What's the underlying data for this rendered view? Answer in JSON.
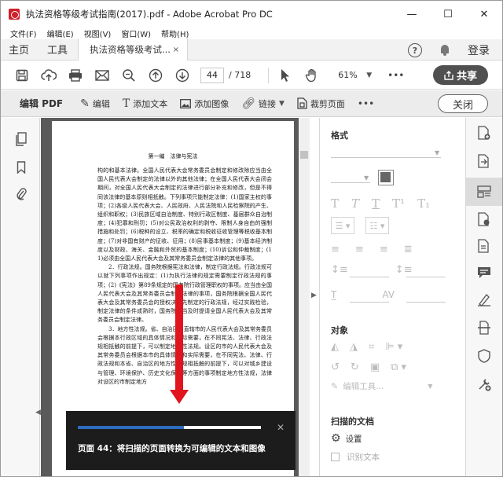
{
  "window": {
    "title": "执法资格等级考试指南(2017).pdf - Adobe Acrobat Pro DC",
    "minimize": "—",
    "maximize": "☐",
    "close": "✕"
  },
  "menu": [
    "文件(F)",
    "编辑(E)",
    "视图(V)",
    "窗口(W)",
    "帮助(H)"
  ],
  "tabs": {
    "home": "主页",
    "tools": "工具",
    "doc": "执法资格等级考试...",
    "doc_close": "×",
    "help": "?",
    "login": "登录"
  },
  "toolbar": {
    "page_current": "44",
    "page_total": "/ 718",
    "zoom": "61%",
    "more": "•••",
    "share": "共享"
  },
  "editbar": {
    "label": "编辑 PDF",
    "tools": [
      "编辑",
      "添加文本",
      "添加图像",
      "链接",
      "裁剪页面"
    ],
    "more": "•••",
    "close": "关闭"
  },
  "page": {
    "header": "第一编　法律与宪法",
    "paragraphs": [
      "构的和基本法律。全国人民代表大会常务委员会制定和修改除应当由全国人民代表大会制定的法律以外的其他法律；在全国人民代表大会闭会期间，对全国人民代表大会制定的法律进行部分补充和修改，但是不得同该法律的基本原则相抵触。下列事项只能制定法律：(1)国家主权的事项；(2)各级人民代表大会、人民政府、人民法院和人民检察院的产生、组织和职权；(3)民族区域自治制度、特别行政区制度、基层群众自治制度；(4)犯罪和刑罚；(5)对公民政治权利的剥夺、限制人身自由的强制措施和处罚；(6)税种的设立、税率的确定和税收征收管理等税收基本制度；(7)对非国有财产的征收、征用；(8)民事基本制度；(9)基本经济制度以及财政、海关、金融和外贸的基本制度；(10)诉讼和仲裁制度；(11)必须由全国人民代表大会及其常务委员会制定法律的其他事项。",
      "2．行政法规。国务院根据宪法和法律，制定行政法规。行政法规可以就下列事项作出规定：(1)为执行法律的规定需要制定行政法规的事项；(2)《宪法》第89条规定的国务院行政管理职权的事项。应当由全国人民代表大会及其常务委员会制定法律的事项，国务院根据全国人民代表大会及其常务委员会的授权决定先制定的行政法规，经过实践检验，制定法律的条件成熟时，国务院应当及时提请全国人民代表大会及其常务委员会制定法律。",
      "3．地方性法规。省、自治区、直辖市的人民代表大会及其常务委员会根据本行政区域的具体情况和实际需要，在不同宪法、法律、行政法规相抵触的前提下，可以制定地方性法规。设区的市的人民代表大会及其常务委员会根据本市的具体情况和实际需要，在不同宪法、法律、行政法规和本省、自治区的地方性法规相抵触的前提下，可以对城乡建设与管理、环境保护、历史文化保护等方面的事项制定地方性法规，法律对设区的市制定地方"
    ]
  },
  "ocr_overlay": {
    "progress_pct": 58,
    "close": "✕",
    "message": "页面 44：将扫描的页面转换为可编辑的文本和图像"
  },
  "right_panel": {
    "format_title": "格式",
    "object_title": "对象",
    "edit_tool": "编辑工具...",
    "scanned_title": "扫描的文档",
    "settings": "设置",
    "recognize": "识别文本"
  }
}
